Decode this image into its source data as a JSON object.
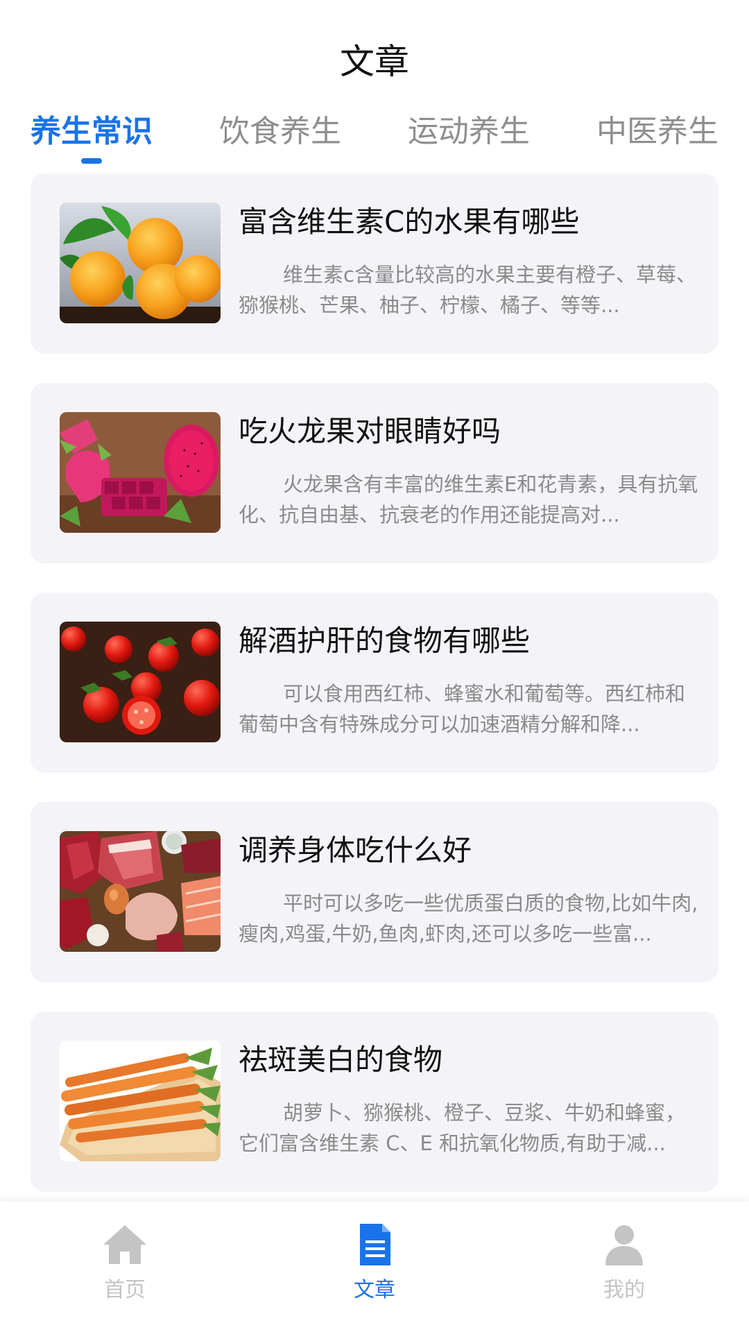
{
  "header": {
    "title": "文章"
  },
  "tabs": [
    {
      "label": "养生常识",
      "active": true
    },
    {
      "label": "饮食养生",
      "active": false
    },
    {
      "label": "运动养生",
      "active": false
    },
    {
      "label": "中医养生",
      "active": false
    }
  ],
  "articles": [
    {
      "title": "富含维生素C的水果有哪些",
      "desc": "维生素c含量比较高的水果主要有橙子、草莓、猕猴桃、芒果、柚子、柠檬、橘子、等等...",
      "image": "oranges"
    },
    {
      "title": "吃火龙果对眼睛好吗",
      "desc": "火龙果含有丰富的维生素E和花青素，具有抗氧化、抗自由基、抗衰老的作用还能提高对...",
      "image": "dragon-fruit"
    },
    {
      "title": "解酒护肝的食物有哪些",
      "desc": "可以食用西红柿、蜂蜜水和葡萄等。西红柿和葡萄中含有特殊成分可以加速酒精分解和降...",
      "image": "tomatoes"
    },
    {
      "title": "调养身体吃什么好",
      "desc": "平时可以多吃一些优质蛋白质的食物,比如牛肉,瘦肉,鸡蛋,牛奶,鱼肉,虾肉,还可以多吃一些富...",
      "image": "meats"
    },
    {
      "title": "祛斑美白的食物",
      "desc": "胡萝卜、猕猴桃、橙子、豆浆、牛奶和蜂蜜，它们富含维生素 C、E 和抗氧化物质,有助于减...",
      "image": "carrots"
    }
  ],
  "bottom_nav": [
    {
      "label": "首页",
      "icon": "home-icon",
      "active": false
    },
    {
      "label": "文章",
      "icon": "document-icon",
      "active": true
    },
    {
      "label": "我的",
      "icon": "user-icon",
      "active": false
    }
  ],
  "colors": {
    "accent": "#1a73e8",
    "card_bg": "#f4f4f8",
    "muted": "#8a8a8a"
  }
}
